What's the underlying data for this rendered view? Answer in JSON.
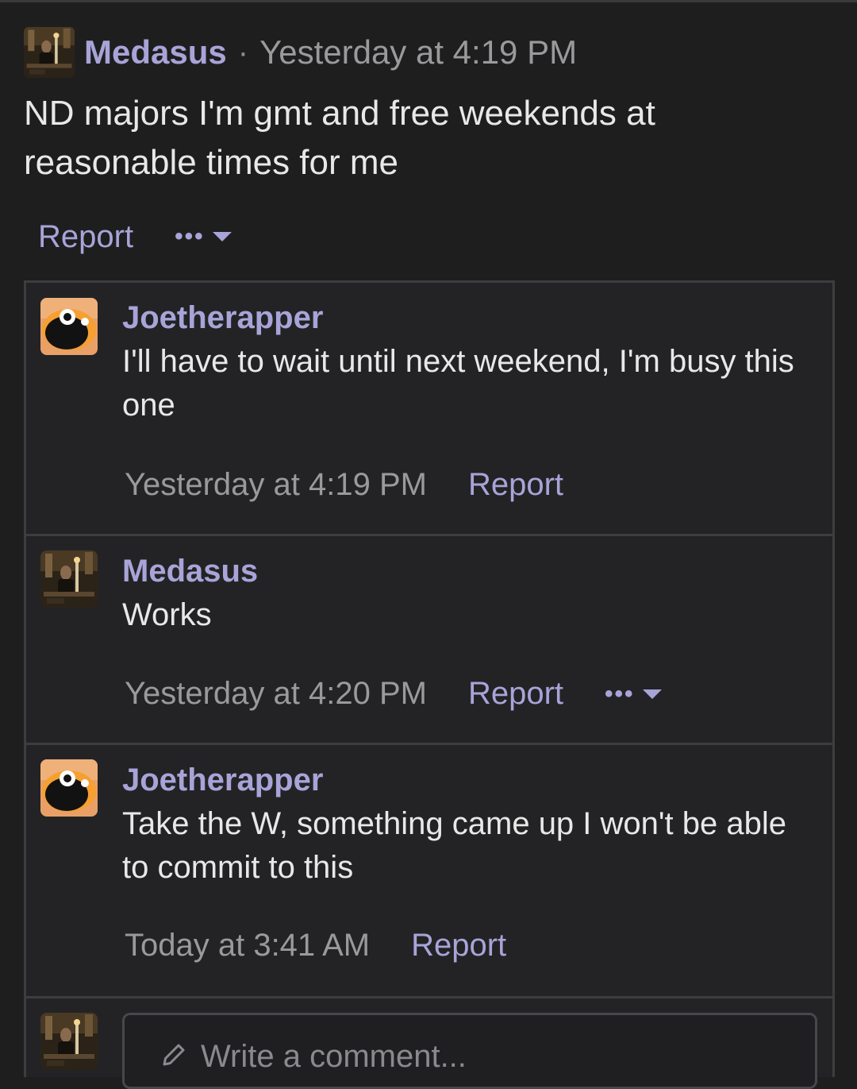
{
  "post": {
    "author": "Medasus",
    "separator": "·",
    "time": "Yesterday at 4:19 PM",
    "body": "ND majors I'm gmt and free weekends at reasonable times for me",
    "report_label": "Report",
    "more_label": "•••"
  },
  "comments": [
    {
      "author": "Joetherapper",
      "text": "I'll have to wait until next weekend, I'm busy this one",
      "time": "Yesterday at 4:19 PM",
      "report_label": "Report"
    },
    {
      "author": "Medasus",
      "text": "Works",
      "time": "Yesterday at 4:20 PM",
      "report_label": "Report",
      "more_label": "•••"
    },
    {
      "author": "Joetherapper",
      "text": "Take the W, something came up I won't be able to commit to this",
      "time": "Today at 3:41 AM",
      "report_label": "Report"
    }
  ],
  "composer": {
    "placeholder": "Write a comment..."
  },
  "icons": {
    "medasus_avatar": "album-cover-avatar",
    "joetherapper_avatar": "orange-face-avatar",
    "more": "ellipsis-icon",
    "caret": "chevron-down-icon",
    "pencil": "pencil-icon"
  },
  "colors": {
    "background": "#1e1e1f",
    "accent": "#a8a4d8",
    "muted": "#9a9a9d"
  }
}
